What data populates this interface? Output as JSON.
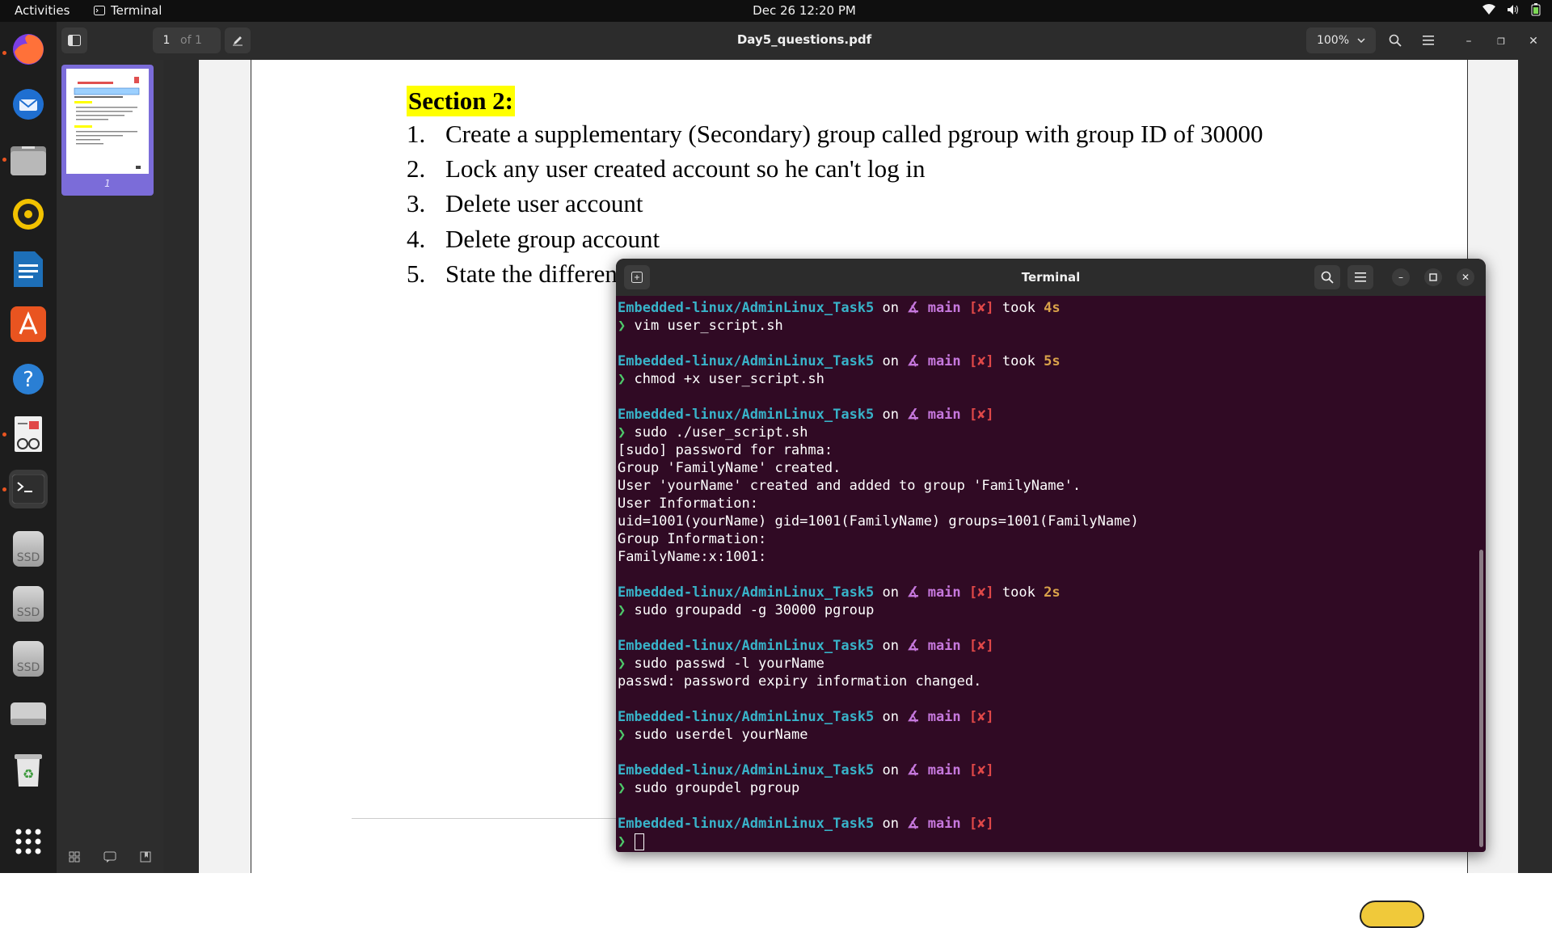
{
  "topbar": {
    "activities": "Activities",
    "app_name": "Terminal",
    "clock": "Dec 26  12:20 PM"
  },
  "pdf_viewer": {
    "page_current": "1",
    "page_total": "of 1",
    "title": "Day5_questions.pdf",
    "zoom": "100%",
    "thumbnail_label": "1"
  },
  "document": {
    "section_title": "Section 2:",
    "questions": [
      {
        "num": "1.",
        "text": "Create a supplementary (Secondary) group called pgroup with group ID of 30000"
      },
      {
        "num": "2.",
        "text": "Lock any user created account so he can't log in"
      },
      {
        "num": "3.",
        "text": "Delete user account"
      },
      {
        "num": "4.",
        "text": "Delete group account"
      },
      {
        "num": "5.",
        "text": "State the difference"
      }
    ]
  },
  "terminal": {
    "title": "Terminal",
    "prompt": {
      "path": "Embedded-linux/AdminLinux_Task5",
      "on": " on ",
      "branch": "∡ main",
      "status": "[✘]",
      "took": "took",
      "arrow": "❯"
    },
    "lines": [
      {
        "type": "prompt",
        "took": "4s"
      },
      {
        "type": "cmd",
        "text": "vim user_script.sh"
      },
      {
        "type": "blank"
      },
      {
        "type": "prompt",
        "took": "5s"
      },
      {
        "type": "cmd",
        "text": "chmod +x user_script.sh"
      },
      {
        "type": "blank"
      },
      {
        "type": "prompt"
      },
      {
        "type": "cmd",
        "text": "sudo ./user_script.sh"
      },
      {
        "type": "out",
        "text": "[sudo] password for rahma:"
      },
      {
        "type": "out",
        "text": "Group 'FamilyName' created."
      },
      {
        "type": "out",
        "text": "User 'yourName' created and added to group 'FamilyName'."
      },
      {
        "type": "out",
        "text": "User Information:"
      },
      {
        "type": "out",
        "text": "uid=1001(yourName) gid=1001(FamilyName) groups=1001(FamilyName)"
      },
      {
        "type": "out",
        "text": "Group Information:"
      },
      {
        "type": "out",
        "text": "FamilyName:x:1001:"
      },
      {
        "type": "blank"
      },
      {
        "type": "prompt",
        "took": "2s"
      },
      {
        "type": "cmd",
        "text": "sudo groupadd -g 30000 pgroup"
      },
      {
        "type": "blank"
      },
      {
        "type": "prompt"
      },
      {
        "type": "cmd",
        "text": "sudo passwd -l yourName"
      },
      {
        "type": "out",
        "text": "passwd: password expiry information changed."
      },
      {
        "type": "blank"
      },
      {
        "type": "prompt"
      },
      {
        "type": "cmd",
        "text": "sudo userdel yourName"
      },
      {
        "type": "blank"
      },
      {
        "type": "prompt"
      },
      {
        "type": "cmd",
        "text": "sudo groupdel pgroup"
      },
      {
        "type": "blank"
      },
      {
        "type": "prompt"
      },
      {
        "type": "input",
        "text": ""
      }
    ]
  },
  "dock": {
    "items": [
      {
        "name": "firefox-icon",
        "color": "#ff7139"
      },
      {
        "name": "thunderbird-icon",
        "color": "#1f6fd1"
      },
      {
        "name": "files-icon",
        "color": "#8a8a8a"
      },
      {
        "name": "rhythmbox-icon",
        "color": "#f2c200"
      },
      {
        "name": "writer-icon",
        "color": "#1d6fb8"
      },
      {
        "name": "app-center-icon",
        "color": "#e95420"
      },
      {
        "name": "help-icon",
        "color": "#2a7fd4"
      },
      {
        "name": "document-viewer-icon",
        "color": "#d0d0d0"
      },
      {
        "name": "terminal-icon",
        "color": "#2e2e2e"
      },
      {
        "name": "ssd-drive-icon",
        "label": "SSD"
      },
      {
        "name": "ssd-drive-icon",
        "label": "SSD"
      },
      {
        "name": "ssd-drive-icon",
        "label": "SSD"
      },
      {
        "name": "drive-icon",
        "color": "#cfcfcf"
      },
      {
        "name": "trash-icon",
        "color": "#5a9e5a"
      },
      {
        "name": "show-apps-icon",
        "color": "#ffffff"
      }
    ]
  },
  "colors": {
    "accent": "#e95420",
    "terminal_bg": "#300a24",
    "thumbnail_selected": "#7b6cd9",
    "highlight": "#ffff00"
  }
}
